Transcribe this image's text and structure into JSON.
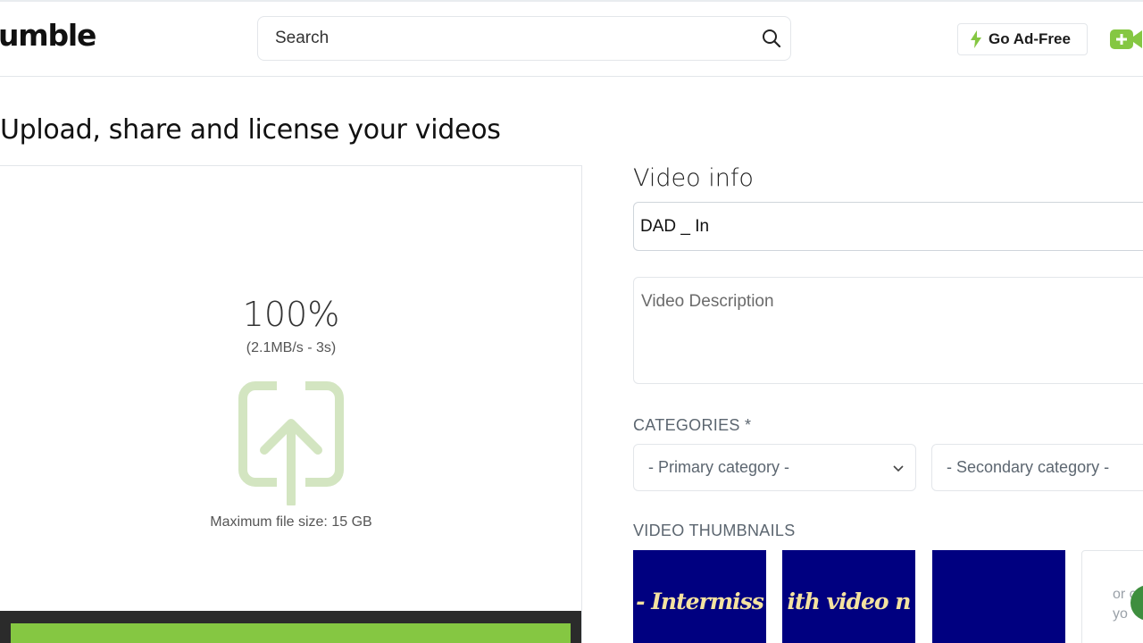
{
  "header": {
    "logo_text": "umble",
    "search_placeholder": "Search",
    "ad_free_label": "Go Ad-Free"
  },
  "page": {
    "title": "Upload, share and license your videos"
  },
  "upload": {
    "percent": "100%",
    "speed": "(2.1MB/s - 3s)",
    "max_size": "Maximum file size: 15 GB",
    "progress_fraction": 1.0
  },
  "form": {
    "heading": "Video info",
    "title_value": "DAD _ In",
    "description_placeholder": "Video Description",
    "categories_label": "CATEGORIES *",
    "primary_category": "- Primary category -",
    "secondary_category": "- Secondary category -",
    "thumbnails_label": "VIDEO THUMBNAILS"
  },
  "thumbnails": [
    {
      "text": "- Intermiss"
    },
    {
      "text": "ith video n"
    },
    {
      "text": ""
    }
  ],
  "thumbnail_upload_text": [
    "or c",
    "yo"
  ],
  "colors": {
    "brand_green": "#85c742",
    "thumb_bg": "#000080",
    "thumb_text": "#f4e2a0"
  }
}
